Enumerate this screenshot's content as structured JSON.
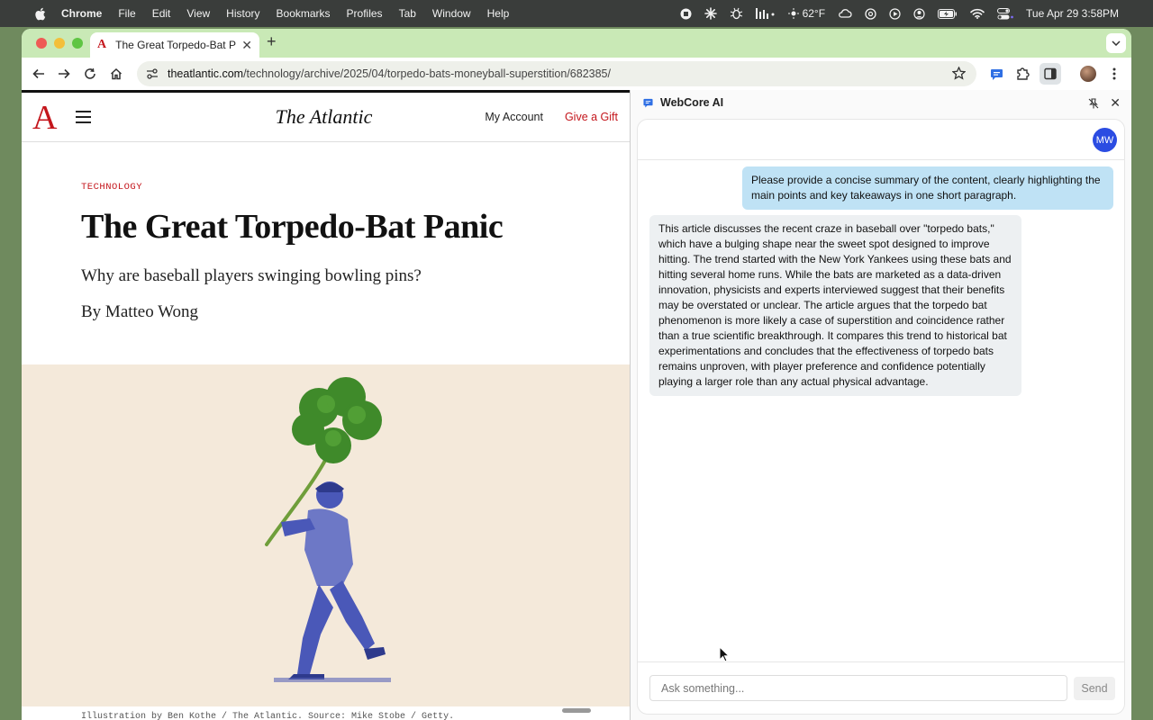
{
  "menubar": {
    "app_name": "Chrome",
    "menus": [
      "File",
      "Edit",
      "View",
      "History",
      "Bookmarks",
      "Profiles",
      "Tab",
      "Window",
      "Help"
    ],
    "weather": "62°F",
    "datetime": "Tue Apr 29  3:58PM"
  },
  "browser": {
    "tab_title": "The Great Torpedo-Bat Panic",
    "url_host": "theatlantic.com",
    "url_path": "/technology/archive/2025/04/torpedo-bats-moneyball-superstition/682385/"
  },
  "page": {
    "logo_letter": "A",
    "masthead": "The Atlantic",
    "my_account": "My Account",
    "give_gift": "Give a Gift",
    "section": "TECHNOLOGY",
    "headline": "The Great Torpedo-Bat Panic",
    "dek": "Why are baseball players swinging bowling pins?",
    "byline": "By Matteo Wong",
    "caption": "Illustration by Ben Kothe / The Atlantic. Source: Mike Stobe / Getty."
  },
  "panel": {
    "title": "WebCore AI",
    "avatar_initials": "MW",
    "user_message": "Please provide a concise summary of the content, clearly highlighting the main points and key takeaways in one short paragraph.",
    "ai_message": "This article discusses the recent craze in baseball over \"torpedo bats,\" which have a bulging shape near the sweet spot designed to improve hitting. The trend started with the New York Yankees using these bats and hitting several home runs. While the bats are marketed as a data-driven innovation, physicists and experts interviewed suggest that their benefits may be overstated or unclear. The article argues that the torpedo bat phenomenon is more likely a case of superstition and coincidence rather than a true scientific breakthrough. It compares this trend to historical bat experimentations and concludes that the effectiveness of torpedo bats remains unproven, with player preference and confidence potentially playing a larger role than any actual physical advantage.",
    "input_placeholder": "Ask something...",
    "send_label": "Send"
  },
  "colors": {
    "accent_red": "#c4161c",
    "tab_strip": "#c9e9b6",
    "user_bubble": "#bfe2f5",
    "avatar_blue": "#2b4ce2"
  }
}
